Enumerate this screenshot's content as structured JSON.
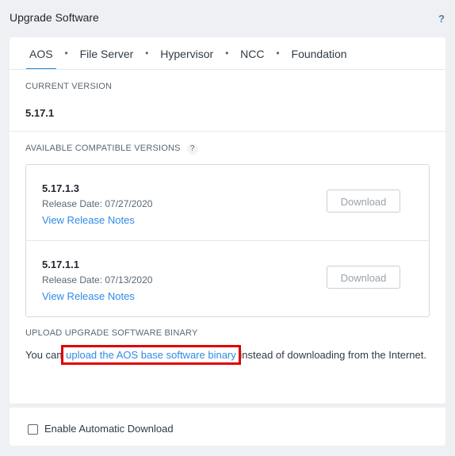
{
  "dialog": {
    "title": "Upgrade Software",
    "help_symbol": "?"
  },
  "tabs": [
    {
      "label": "AOS",
      "active": true
    },
    {
      "label": "File Server"
    },
    {
      "label": "Hypervisor"
    },
    {
      "label": "NCC"
    },
    {
      "label": "Foundation"
    }
  ],
  "tab_separator": "•",
  "current": {
    "label": "CURRENT VERSION",
    "version": "5.17.1"
  },
  "available": {
    "label": "AVAILABLE COMPATIBLE VERSIONS",
    "help_symbol": "?",
    "versions": [
      {
        "name": "5.17.1.3",
        "release_date": "Release Date: 07/27/2020",
        "notes_link": "View Release Notes",
        "button": "Download"
      },
      {
        "name": "5.17.1.1",
        "release_date": "Release Date: 07/13/2020",
        "notes_link": "View Release Notes",
        "button": "Download"
      }
    ]
  },
  "upload": {
    "label": "UPLOAD UPGRADE SOFTWARE BINARY",
    "text_before": "You can ",
    "link": "upload the AOS base software binary",
    "text_after": " instead of downloading from the Internet."
  },
  "auto_download": {
    "label": "Enable Automatic Download",
    "checked": false
  },
  "colors": {
    "accent": "#1f8ae0",
    "link": "#2f8be6",
    "highlight": "#e00000"
  }
}
